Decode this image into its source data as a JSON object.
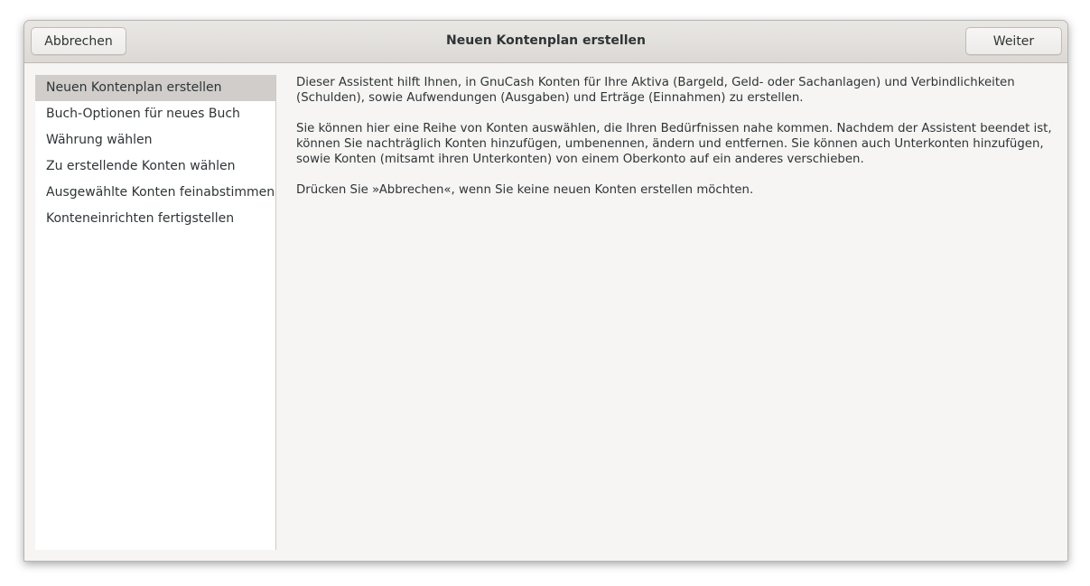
{
  "header": {
    "cancel_label": "Abbrechen",
    "title": "Neuen Kontenplan erstellen",
    "next_label": "Weiter"
  },
  "sidebar": {
    "items": [
      {
        "label": "Neuen Kontenplan erstellen",
        "active": true
      },
      {
        "label": "Buch-Optionen für neues Buch",
        "active": false
      },
      {
        "label": "Währung wählen",
        "active": false
      },
      {
        "label": "Zu erstellende Konten wählen",
        "active": false
      },
      {
        "label": "Ausgewählte Konten feinabstimmen",
        "active": false
      },
      {
        "label": "Konteneinrichten fertigstellen",
        "active": false
      }
    ]
  },
  "main": {
    "paragraphs": [
      "Dieser Assistent hilft Ihnen, in GnuCash Konten für Ihre Aktiva (Bargeld, Geld- oder Sachanlagen) und Verbindlichkeiten\n(Schulden), sowie Aufwendungen (Ausgaben) und Erträge (Einnahmen) zu erstellen.",
      "Sie können hier eine Reihe von Konten auswählen, die Ihren Bedürfnissen nahe kommen. Nachdem der Assistent beendet ist,\nkönnen Sie nachträglich Konten hinzufügen, umbenennen, ändern und entfernen. Sie können auch Unterkonten hinzufügen,\nsowie Konten (mitsamt ihren Unterkonten) von einem Oberkonto auf ein anderes verschieben.",
      "Drücken Sie »Abbrechen«, wenn Sie keine neuen Konten erstellen möchten."
    ]
  }
}
